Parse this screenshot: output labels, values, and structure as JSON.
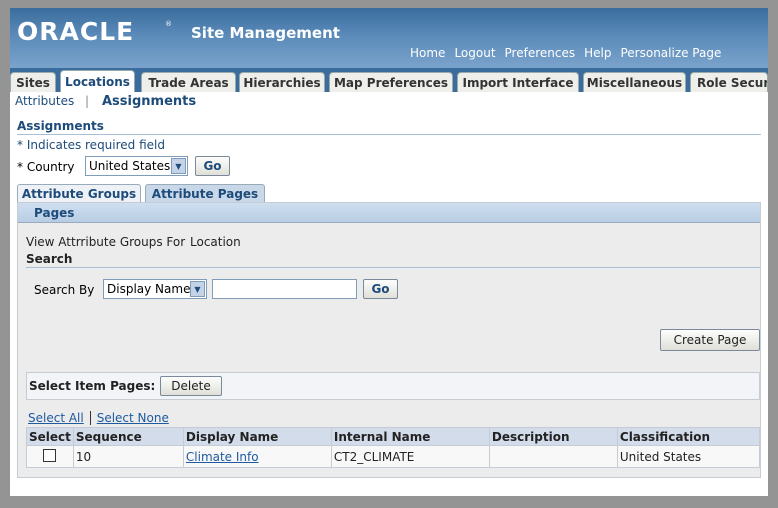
{
  "header": {
    "logo": "ORACLE",
    "logo_mark": "®",
    "app_title": "Site Management",
    "global_links": [
      "Home",
      "Logout",
      "Preferences",
      "Help",
      "Personalize Page"
    ]
  },
  "tabs": [
    {
      "label": "Sites"
    },
    {
      "label": "Locations",
      "active": true
    },
    {
      "label": "Trade Areas"
    },
    {
      "label": "Hierarchies"
    },
    {
      "label": "Map Preferences"
    },
    {
      "label": "Import Interface"
    },
    {
      "label": "Miscellaneous"
    },
    {
      "label": "Role Secur"
    }
  ],
  "subnav": {
    "attributes": "Attributes",
    "separator": "|",
    "assignments": "Assignments"
  },
  "page": {
    "title": "Assignments",
    "required_note": "* Indicates required field",
    "country_label": "* Country",
    "country_value": "United States",
    "go_label": "Go"
  },
  "subtabs": {
    "groups": "Attribute Groups",
    "pages": "Attribute Pages"
  },
  "panel": {
    "title": "Pages",
    "view_label": "View Attrribute Groups For",
    "view_value": "Location",
    "search_title": "Search",
    "search_by_label": "Search By",
    "search_by_value": "Display Name",
    "search_value": "",
    "search_go": "Go",
    "create_page": "Create Page",
    "select_label": "Select Item Pages:",
    "delete": "Delete",
    "select_all": "Select All",
    "select_none": "Select None"
  },
  "table": {
    "columns": [
      "Select",
      "Sequence",
      "Display Name",
      "Internal Name",
      "Description",
      "Classification"
    ],
    "rows": [
      {
        "sequence": "10",
        "display_name": "Climate Info",
        "internal_name": "CT2_CLIMATE",
        "description": "",
        "classification": "United States"
      }
    ]
  }
}
